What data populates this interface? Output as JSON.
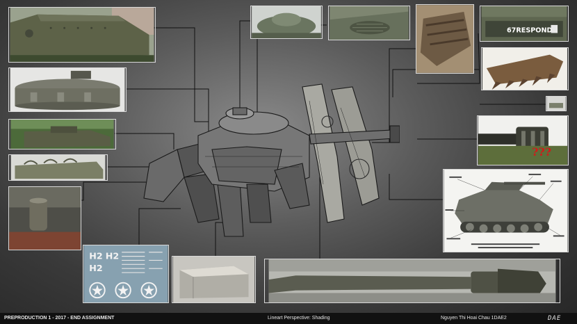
{
  "footer": {
    "left": "PREPRODUCTION 1 - 2017 - END ASSIGNMENT",
    "center": "Lineart Perspective: Shading",
    "right": "Nguyen Thi Hoai Chau 1DAE2",
    "logo": "DAE"
  },
  "references": {
    "tank_plate": "67RESPOND",
    "question_marks": "???",
    "sticker_codes": [
      "H2",
      "H2",
      "H2"
    ]
  },
  "colors": {
    "background_center": "#8a8a8a",
    "background_edge": "#262626",
    "leader_lines": "#111111",
    "olive_drab": "#5d6248",
    "accent_red": "#d21a1a"
  }
}
